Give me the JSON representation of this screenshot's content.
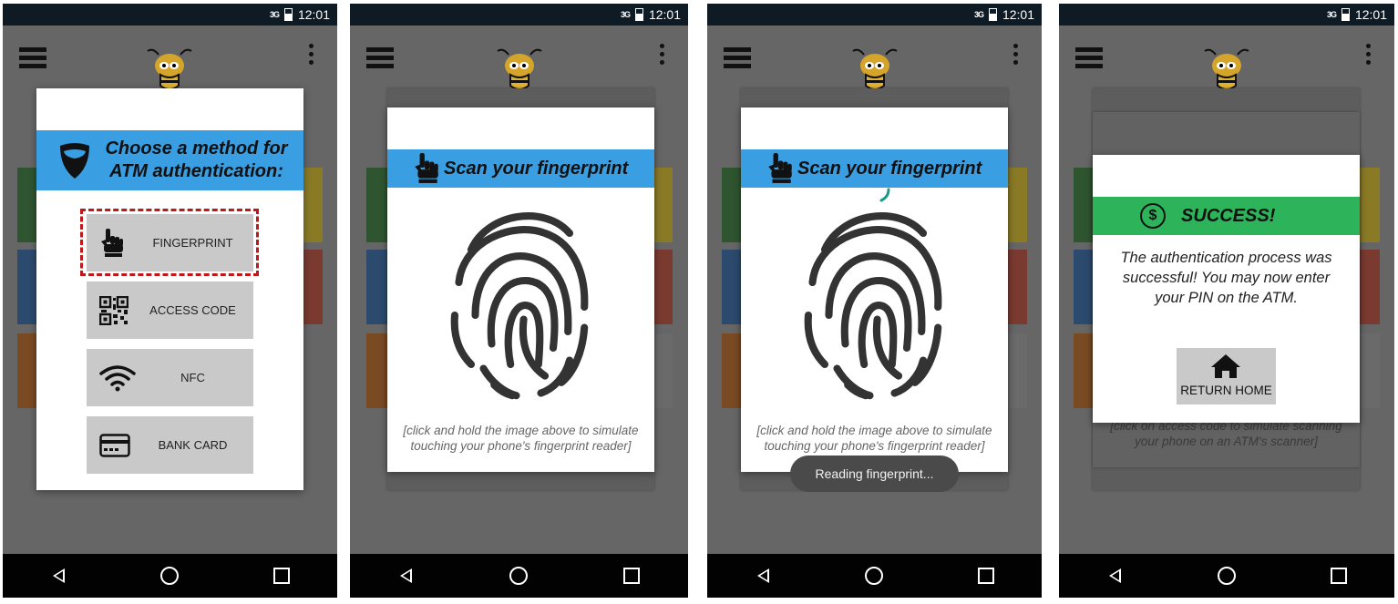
{
  "status": {
    "network": "3G",
    "time": "12:01"
  },
  "screen1": {
    "title_line1": "Choose a method for",
    "title_line2": "ATM authentication:",
    "options": [
      {
        "label": "FINGERPRINT",
        "icon": "hand-pointer-icon",
        "selected": true
      },
      {
        "label": "ACCESS CODE",
        "icon": "qr-code-icon"
      },
      {
        "label": "NFC",
        "icon": "wifi-icon"
      },
      {
        "label": "BANK CARD",
        "icon": "credit-card-icon"
      }
    ]
  },
  "screen2": {
    "title": "Scan your fingerprint",
    "hint_line1": "[click and hold the image above to simulate",
    "hint_line2": "touching your phone's fingerprint reader]"
  },
  "screen3": {
    "title": "Scan your fingerprint",
    "hint_line1": "[click and hold the image above to simulate",
    "hint_line2": "touching your phone's fingerprint reader]",
    "toast": "Reading fingerprint..."
  },
  "screen4": {
    "title": "SUCCESS!",
    "message_line1": "The authentication process was",
    "message_line2": "successful! You may now enter",
    "message_line3": "your PIN on the ATM.",
    "button_label": "RETURN HOME",
    "behind_line1": "[click on access code to simulate scanning",
    "behind_line2": "your phone on an ATM's scanner]"
  },
  "colors": {
    "banner_blue": "#3a9ee2",
    "banner_green": "#2db45a",
    "selection_border": "#c01818",
    "tile_green": "#2e7d32",
    "tile_yellow": "#d4b417",
    "tile_blue": "#1f5fa6",
    "tile_red": "#b23a2e",
    "tile_orange": "#c56a1a",
    "tile_gray": "#9a9a9a"
  }
}
